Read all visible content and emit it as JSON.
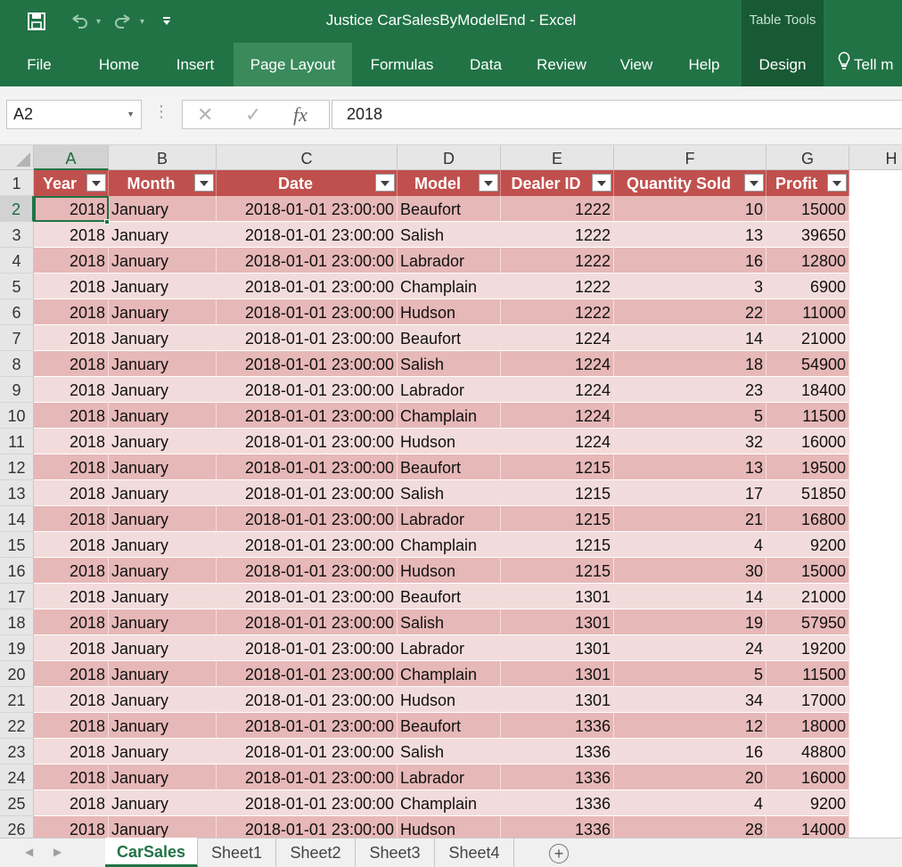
{
  "window": {
    "title": "Justice CarSalesByModelEnd  -  Excel",
    "table_tools_label": "Table Tools",
    "colors": {
      "ribbon": "#217346",
      "header_band": "#c0504d",
      "band_dark": "#e6b8b7",
      "band_light": "#f2dcdb"
    }
  },
  "qat": {
    "save_icon": "save-icon",
    "undo_icon": "undo-icon",
    "redo_icon": "redo-icon",
    "customize_icon": "customize-qat-icon"
  },
  "ribbon": {
    "tabs": [
      "File",
      "Home",
      "Insert",
      "Page Layout",
      "Formulas",
      "Data",
      "Review",
      "View",
      "Help",
      "Design"
    ],
    "active_tab": "Page Layout",
    "tell_me": "Tell m"
  },
  "formula_bar": {
    "name_box": "A2",
    "cancel_glyph": "✕",
    "enter_glyph": "✓",
    "fx_glyph": "fx",
    "value": "2018"
  },
  "sheet": {
    "column_letters": [
      "A",
      "B",
      "C",
      "D",
      "E",
      "F",
      "G",
      "H"
    ],
    "selected_column": "A",
    "selected_row": "2",
    "headers": [
      "Year",
      "Month",
      "Date",
      "Model",
      "Dealer ID",
      "Quantity Sold",
      "Profit"
    ],
    "header_display": [
      "Year",
      "Month",
      "Date",
      "Model",
      "Dealer ID",
      "Quantity Sold",
      "Profit"
    ],
    "row_numbers": [
      "1",
      "2",
      "3",
      "4",
      "5",
      "6",
      "7",
      "8",
      "9",
      "10",
      "11",
      "12",
      "13",
      "14",
      "15",
      "16",
      "17",
      "18",
      "19",
      "20",
      "21",
      "22",
      "23",
      "24",
      "25",
      "26"
    ],
    "rows": [
      [
        "2018",
        "January",
        "2018-01-01 23:00:00",
        "Beaufort",
        "1222",
        "10",
        "15000"
      ],
      [
        "2018",
        "January",
        "2018-01-01 23:00:00",
        "Salish",
        "1222",
        "13",
        "39650"
      ],
      [
        "2018",
        "January",
        "2018-01-01 23:00:00",
        "Labrador",
        "1222",
        "16",
        "12800"
      ],
      [
        "2018",
        "January",
        "2018-01-01 23:00:00",
        "Champlain",
        "1222",
        "3",
        "6900"
      ],
      [
        "2018",
        "January",
        "2018-01-01 23:00:00",
        "Hudson",
        "1222",
        "22",
        "11000"
      ],
      [
        "2018",
        "January",
        "2018-01-01 23:00:00",
        "Beaufort",
        "1224",
        "14",
        "21000"
      ],
      [
        "2018",
        "January",
        "2018-01-01 23:00:00",
        "Salish",
        "1224",
        "18",
        "54900"
      ],
      [
        "2018",
        "January",
        "2018-01-01 23:00:00",
        "Labrador",
        "1224",
        "23",
        "18400"
      ],
      [
        "2018",
        "January",
        "2018-01-01 23:00:00",
        "Champlain",
        "1224",
        "5",
        "11500"
      ],
      [
        "2018",
        "January",
        "2018-01-01 23:00:00",
        "Hudson",
        "1224",
        "32",
        "16000"
      ],
      [
        "2018",
        "January",
        "2018-01-01 23:00:00",
        "Beaufort",
        "1215",
        "13",
        "19500"
      ],
      [
        "2018",
        "January",
        "2018-01-01 23:00:00",
        "Salish",
        "1215",
        "17",
        "51850"
      ],
      [
        "2018",
        "January",
        "2018-01-01 23:00:00",
        "Labrador",
        "1215",
        "21",
        "16800"
      ],
      [
        "2018",
        "January",
        "2018-01-01 23:00:00",
        "Champlain",
        "1215",
        "4",
        "9200"
      ],
      [
        "2018",
        "January",
        "2018-01-01 23:00:00",
        "Hudson",
        "1215",
        "30",
        "15000"
      ],
      [
        "2018",
        "January",
        "2018-01-01 23:00:00",
        "Beaufort",
        "1301",
        "14",
        "21000"
      ],
      [
        "2018",
        "January",
        "2018-01-01 23:00:00",
        "Salish",
        "1301",
        "19",
        "57950"
      ],
      [
        "2018",
        "January",
        "2018-01-01 23:00:00",
        "Labrador",
        "1301",
        "24",
        "19200"
      ],
      [
        "2018",
        "January",
        "2018-01-01 23:00:00",
        "Champlain",
        "1301",
        "5",
        "11500"
      ],
      [
        "2018",
        "January",
        "2018-01-01 23:00:00",
        "Hudson",
        "1301",
        "34",
        "17000"
      ],
      [
        "2018",
        "January",
        "2018-01-01 23:00:00",
        "Beaufort",
        "1336",
        "12",
        "18000"
      ],
      [
        "2018",
        "January",
        "2018-01-01 23:00:00",
        "Salish",
        "1336",
        "16",
        "48800"
      ],
      [
        "2018",
        "January",
        "2018-01-01 23:00:00",
        "Labrador",
        "1336",
        "20",
        "16000"
      ],
      [
        "2018",
        "January",
        "2018-01-01 23:00:00",
        "Champlain",
        "1336",
        "4",
        "9200"
      ],
      [
        "2018",
        "January",
        "2018-01-01 23:00:00",
        "Hudson",
        "1336",
        "28",
        "14000"
      ]
    ],
    "column_align": [
      "r",
      "l",
      "r",
      "l",
      "r",
      "r",
      "r"
    ]
  },
  "sheet_tabs": {
    "tabs": [
      "CarSales",
      "Sheet1",
      "Sheet2",
      "Sheet3",
      "Sheet4"
    ],
    "active": "CarSales",
    "add_glyph": "+"
  }
}
